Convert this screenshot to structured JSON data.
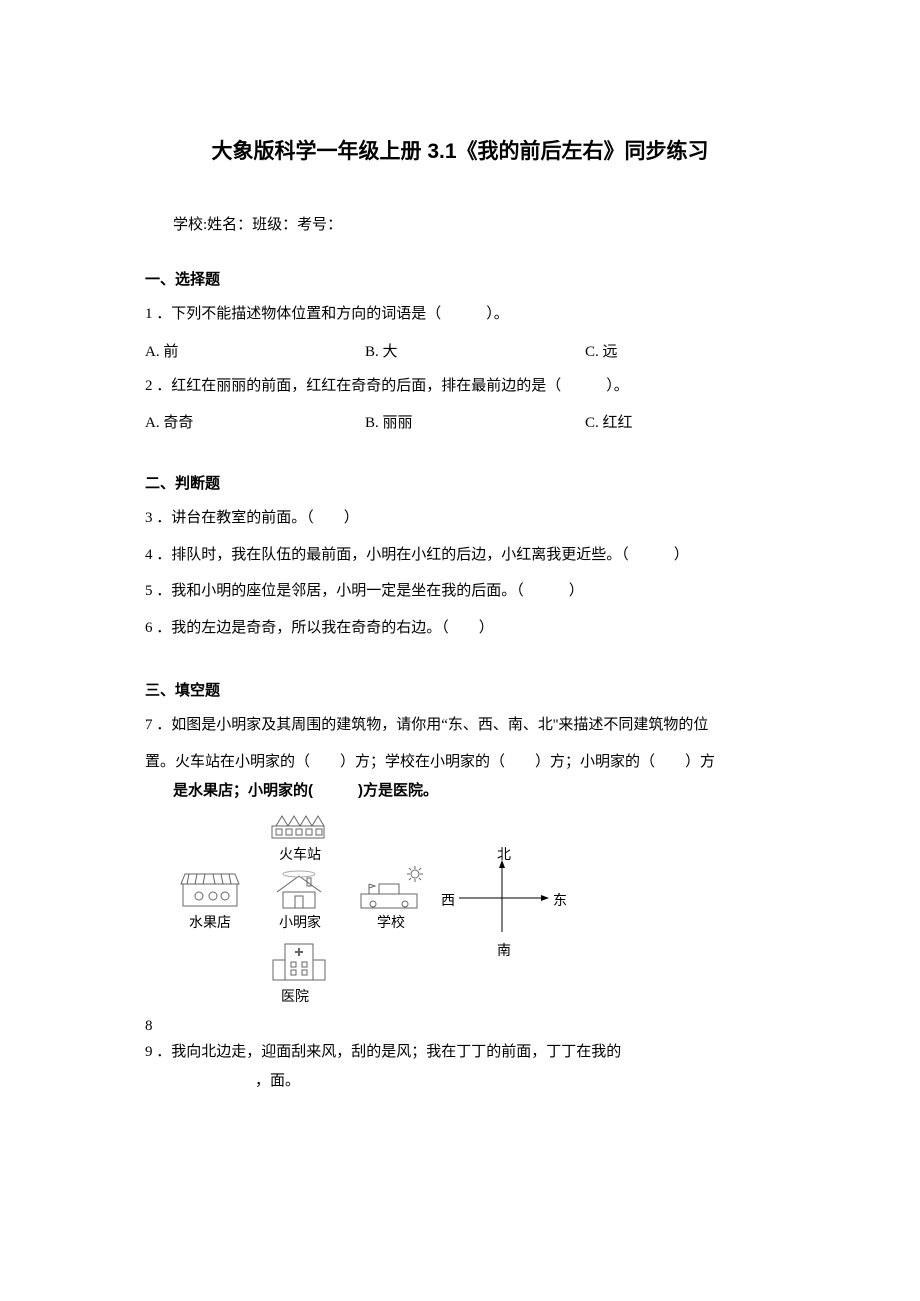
{
  "title": "大象版科学一年级上册 3.1《我的前后左右》同步练习",
  "meta": "学校:姓名：班级：考号：",
  "s1": {
    "heading": "一、选择题",
    "q1": {
      "text": "1 ．下列不能描述物体位置和方向的词语是（　　　）。",
      "a": "A. 前",
      "b": "B. 大",
      "c": "C. 远"
    },
    "q2": {
      "text": "2 ．红红在丽丽的前面，红红在奇奇的后面，排在最前边的是（　　　）。",
      "a": "A. 奇奇",
      "b": "B. 丽丽",
      "c": "C. 红红"
    }
  },
  "s2": {
    "heading": "二、判断题",
    "q3": "3 ．讲台在教室的前面。（　　）",
    "q4": "4 ．排队时，我在队伍的最前面，小明在小红的后边，小红离我更近些。（　　　）",
    "q5": "5 ．我和小明的座位是邻居，小明一定是坐在我的后面。（　　　）",
    "q6": "6 ．我的左边是奇奇，所以我在奇奇的右边。（　　）"
  },
  "s3": {
    "heading": "三、填空题",
    "q7a": "7 ．如图是小明家及其周围的建筑物，请你用“东、西、南、北''来描述不同建筑物的位",
    "q7b": "置。火车站在小明家的（　　）方；学校在小明家的（　　）方；小明家的（　　）方",
    "q7c": "是水果店；小明家的(　　　)方是医院。",
    "fig": {
      "train": "火车站",
      "fruit": "水果店",
      "home": "小明家",
      "school": "学校",
      "hospital": "医院",
      "north": "北",
      "south": "南",
      "east": "东",
      "west": "西"
    },
    "q8mark": "8",
    "q9a": "9 ．我向北边走，迎面刮来风，刮的是风；我在丁丁的前面，丁丁在我的",
    "q9b": "，面。"
  }
}
